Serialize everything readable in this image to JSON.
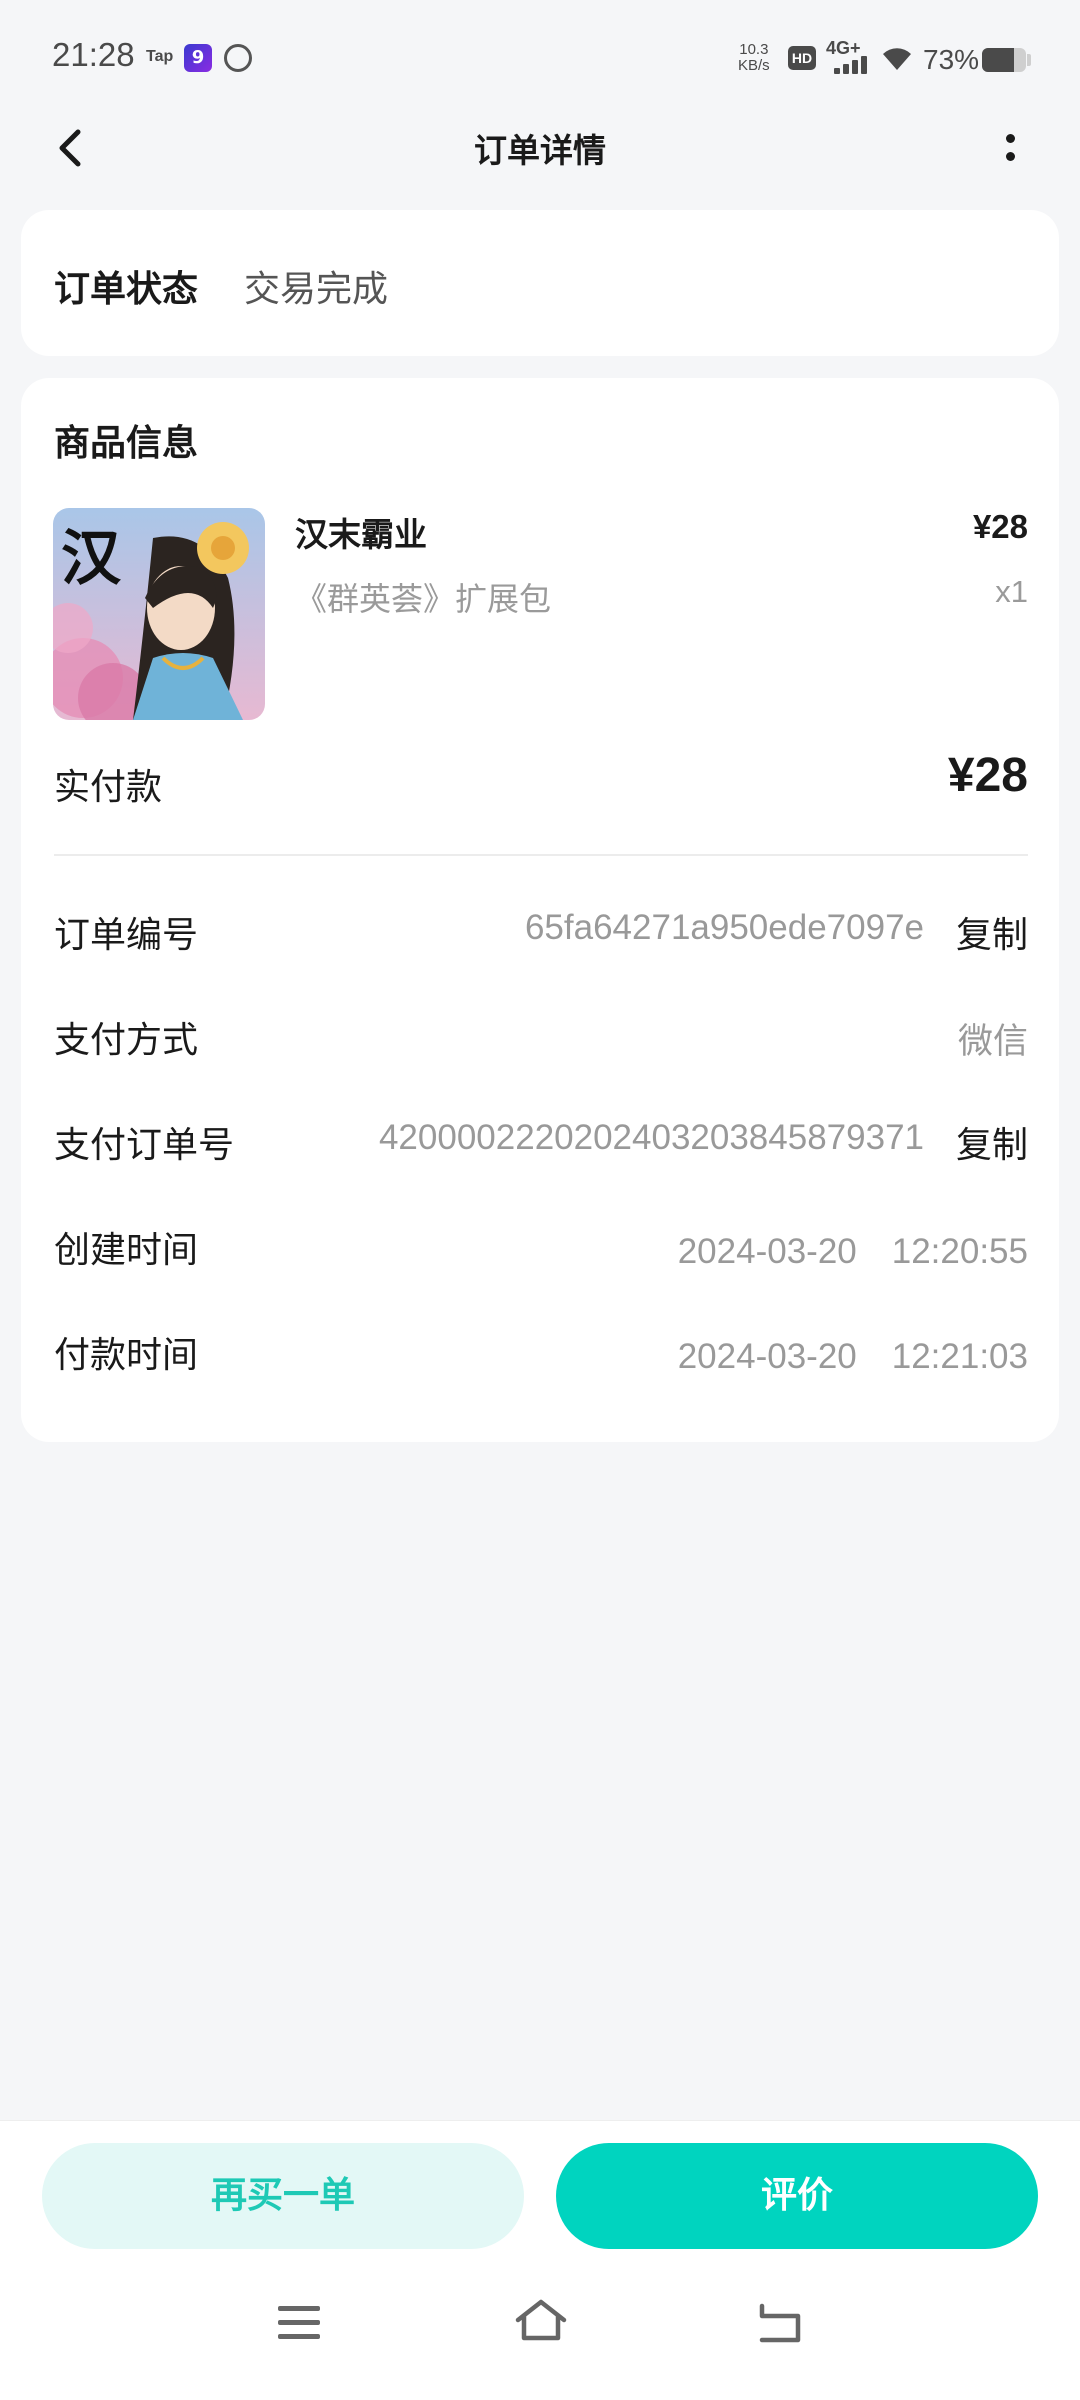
{
  "status_bar": {
    "time": "21:28",
    "tap_label": "Tap",
    "app_icon_glyph": "9",
    "speed_value": "10.3",
    "speed_unit": "KB/s",
    "hd_label": "HD",
    "network_label": "4G+",
    "battery_percent": "73%",
    "battery_level": 0.73
  },
  "header": {
    "title": "订单详情",
    "back_icon": "chevron-left-icon",
    "more_icon": "more-vertical-icon"
  },
  "order_status": {
    "label": "订单状态",
    "value": "交易完成"
  },
  "product_section": {
    "title": "商品信息",
    "product": {
      "name": "汉末霸业",
      "price": "¥28",
      "description": "《群英荟》扩展包",
      "quantity": "x1",
      "thumb_char": "汉"
    },
    "paid_label": "实付款",
    "paid_value": "¥28"
  },
  "details": {
    "order_no": {
      "label": "订单编号",
      "value": "65fa64271a950ede7097e",
      "copy": "复制"
    },
    "pay_method": {
      "label": "支付方式",
      "value": "微信"
    },
    "pay_order_no": {
      "label": "支付订单号",
      "value": "4200002220202403203845879371",
      "copy": "复制"
    },
    "created_time": {
      "label": "创建时间",
      "value": "2024-03-20　12:20:55"
    },
    "paid_time": {
      "label": "付款时间",
      "value": "2024-03-20　12:21:03"
    }
  },
  "actions": {
    "rebuy": "再买一单",
    "review": "评价"
  },
  "colors": {
    "accent": "#00d4bf",
    "accent_light": "#e3f8f6",
    "background": "#f5f6f8"
  }
}
